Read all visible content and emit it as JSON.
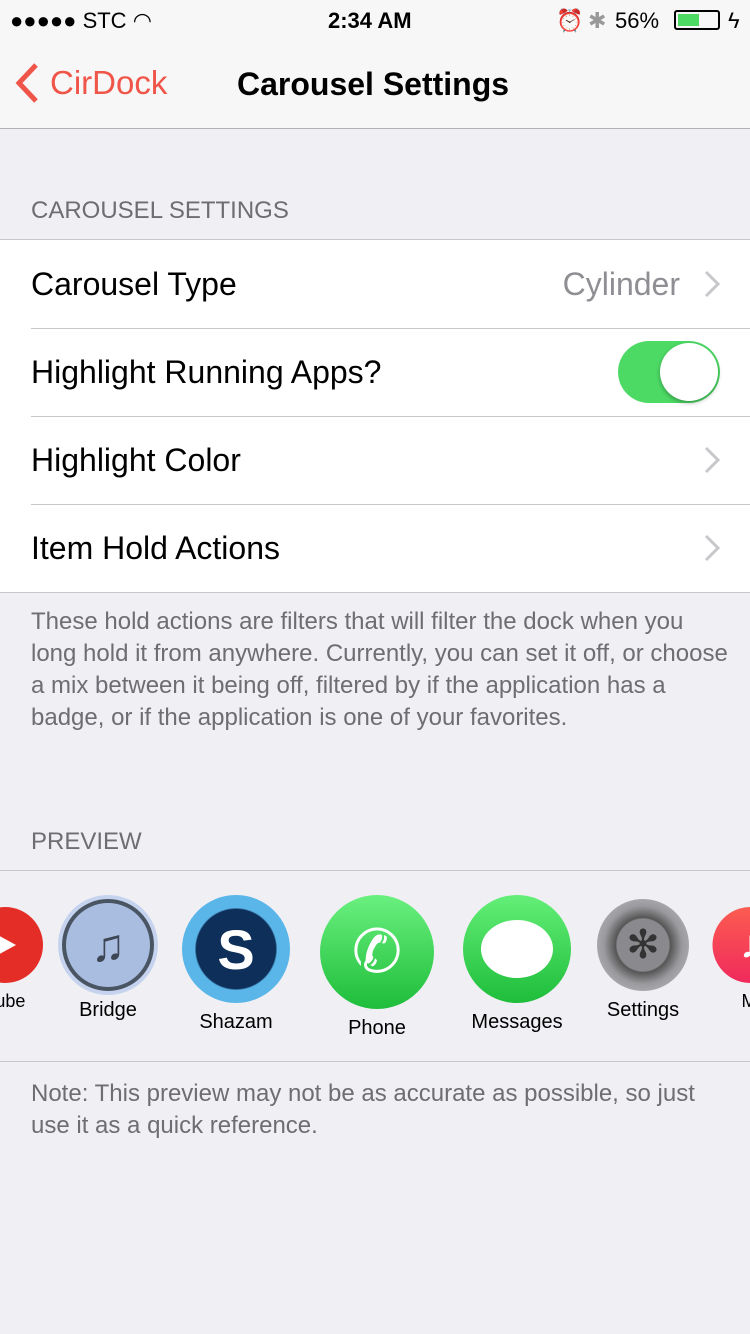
{
  "status": {
    "carrier": "STC",
    "time": "2:34 AM",
    "battery": "56%",
    "battery_level": 56
  },
  "nav": {
    "back_label": "CirDock",
    "title": "Carousel Settings"
  },
  "carousel_section": {
    "header": "CAROUSEL SETTINGS",
    "rows": [
      {
        "label": "Carousel Type",
        "value": "Cylinder"
      },
      {
        "label": "Highlight Running Apps?",
        "toggle": true
      },
      {
        "label": "Highlight Color"
      },
      {
        "label": "Item Hold Actions"
      }
    ],
    "footer": "These hold actions are filters that will filter the dock when you long hold it from anywhere. Currently, you can set it off, or choose a mix between it being off, filtered by if the application has a badge, or if the application is one of your favorites."
  },
  "preview": {
    "header": "PREVIEW",
    "apps": [
      {
        "label": "YouTube"
      },
      {
        "label": "Bridge"
      },
      {
        "label": "Shazam"
      },
      {
        "label": "Phone"
      },
      {
        "label": "Messages"
      },
      {
        "label": "Settings"
      },
      {
        "label": "Music"
      }
    ],
    "footer": "Note: This preview may not be as accurate as possible, so just use it as a quick reference."
  },
  "colors": {
    "accent": "#f0554a",
    "toggle_on": "#4cd964",
    "battery": "#4cd964"
  }
}
